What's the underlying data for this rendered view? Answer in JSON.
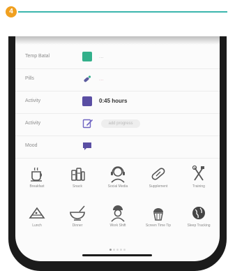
{
  "step": {
    "number": "4"
  },
  "rows": [
    {
      "label": "Temp Batal",
      "value": "...",
      "color": "#33b08b",
      "kind": "text"
    },
    {
      "label": "Pills",
      "value": "...",
      "color": "#5b5b9e",
      "kind": "text"
    },
    {
      "label": "Activity",
      "value": "0:45 hours",
      "color": "#5a4ea3",
      "kind": "text"
    },
    {
      "label": "Activity",
      "value": "add progress",
      "color": "#6f64c2",
      "kind": "pill"
    },
    {
      "label": "Mood",
      "value": "",
      "color": "#5a4ea3",
      "kind": "text"
    }
  ],
  "grid": [
    {
      "label": "Breakfast",
      "icon": "coffee-cup-icon"
    },
    {
      "label": "Snack",
      "icon": "juice-bottles-icon"
    },
    {
      "label": "Social Media",
      "icon": "headset-person-icon"
    },
    {
      "label": "Supplement",
      "icon": "capsule-pill-icon"
    },
    {
      "label": "Training",
      "icon": "tools-icon"
    },
    {
      "label": "Lunch",
      "icon": "sandwich-icon"
    },
    {
      "label": "Dinner",
      "icon": "bowl-icon"
    },
    {
      "label": "Work Shift",
      "icon": "worker-person-icon"
    },
    {
      "label": "Screen Time Tip",
      "icon": "cupcake-icon"
    },
    {
      "label": "Sleep Tracking",
      "icon": "globe-icon"
    }
  ],
  "pagination": {
    "total": 5,
    "active": 0
  }
}
